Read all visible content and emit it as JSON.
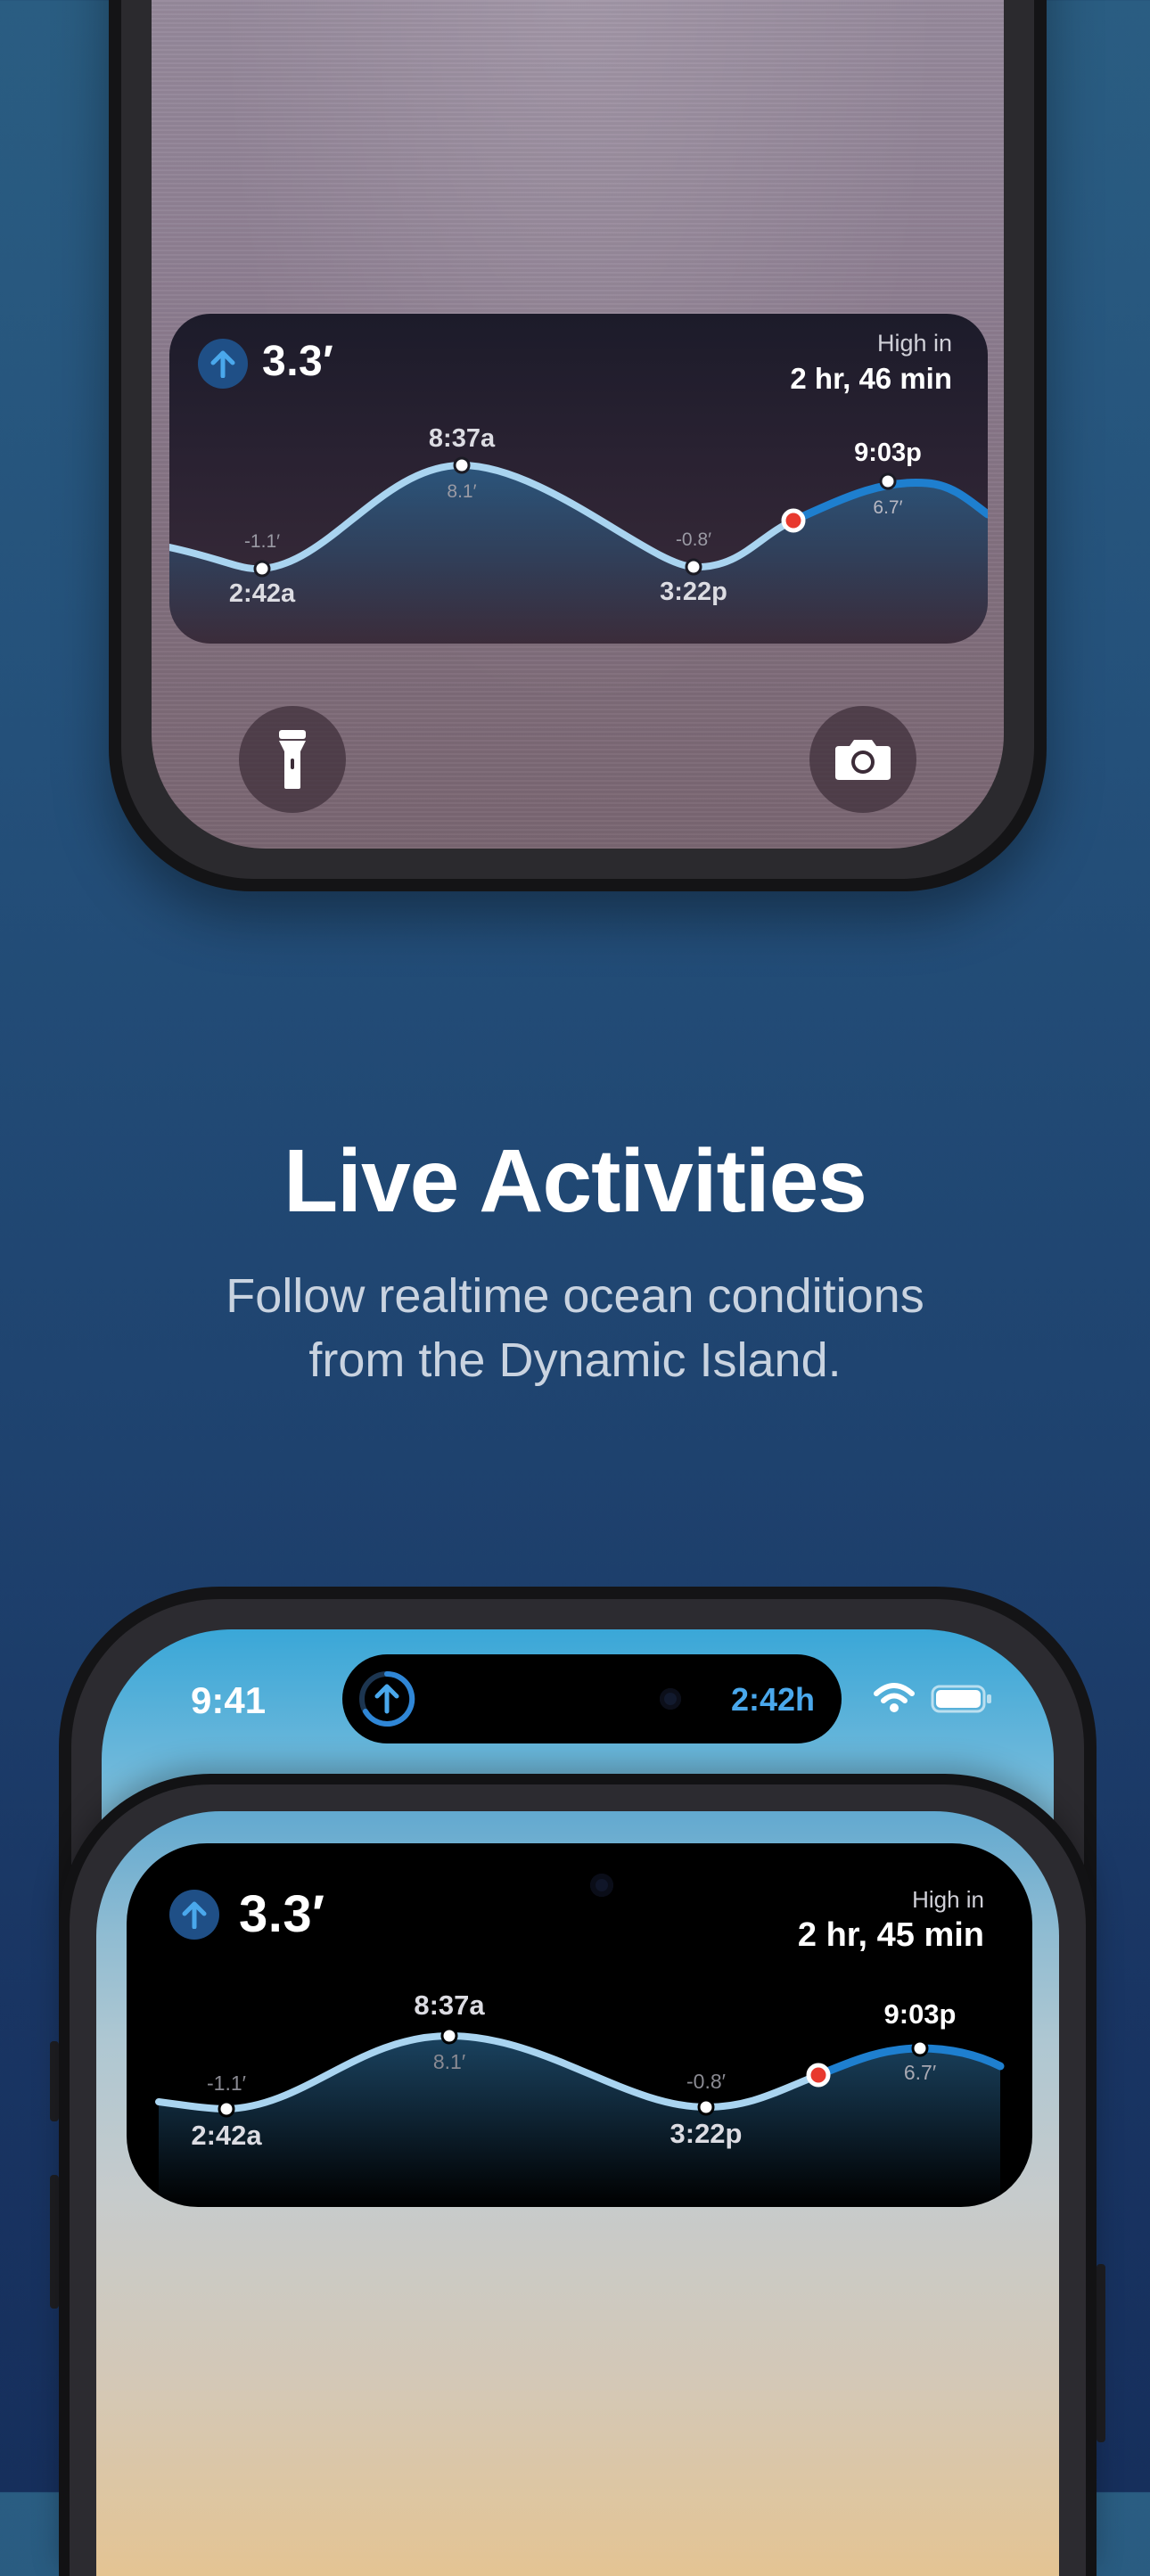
{
  "colors": {
    "accent": "#4aa8ec",
    "tide_curve": "#a9d4f0",
    "tide_future": "#1e7fcf",
    "current_marker": "#e8392e"
  },
  "top_phone": {
    "live_activity": {
      "direction_icon": "arrow-up-icon",
      "current_height": "3.3′",
      "next_label": "High in",
      "next_time": "2 hr, 46 min",
      "tides": [
        {
          "time": "2:42a",
          "height": "-1.1′"
        },
        {
          "time": "8:37a",
          "height": "8.1′"
        },
        {
          "time": "3:22p",
          "height": "-0.8′"
        },
        {
          "time": "9:03p",
          "height": "6.7′"
        }
      ]
    },
    "buttons": {
      "left": "flashlight-icon",
      "right": "camera-icon"
    }
  },
  "marketing": {
    "headline": "Live Activities",
    "subline_1": "Follow realtime ocean conditions",
    "subline_2": "from the Dynamic Island."
  },
  "bottom_phone": {
    "status_time": "9:41",
    "dynamic_island": {
      "icon": "tide-arrow-up-icon",
      "time": "2:42h"
    },
    "status_icons": [
      "wifi-icon",
      "battery-icon"
    ],
    "live_activity": {
      "direction_icon": "arrow-up-icon",
      "current_height": "3.3′",
      "next_label": "High in",
      "next_time": "2 hr, 45 min",
      "tides": [
        {
          "time": "2:42a",
          "height": "-1.1′"
        },
        {
          "time": "8:37a",
          "height": "8.1′"
        },
        {
          "time": "3:22p",
          "height": "-0.8′"
        },
        {
          "time": "9:03p",
          "height": "6.7′"
        }
      ]
    }
  }
}
